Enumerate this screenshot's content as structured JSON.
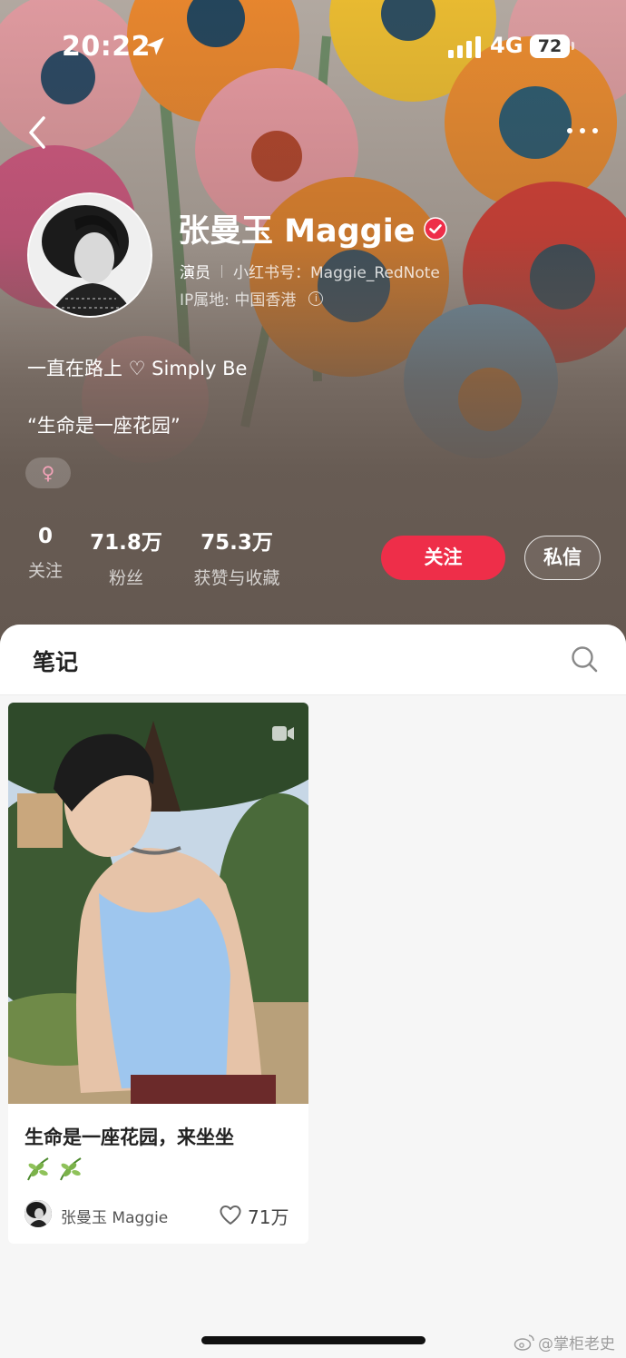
{
  "status_bar": {
    "time": "20:22",
    "network": "4G",
    "battery": "72"
  },
  "profile": {
    "name": "张曼玉 Maggie",
    "role": "演员",
    "redbook_id": "小红书号：Maggie_RedNote",
    "ip_location": "IP属地: 中国香港",
    "bio_line1": "一直在路上 ♡ Simply Be",
    "bio_line2": "“生命是一座花园”",
    "gender_symbol": "♀"
  },
  "stats": [
    {
      "value": "0",
      "label": "关注"
    },
    {
      "value": "71.8万",
      "label": "粉丝"
    },
    {
      "value": "75.3万",
      "label": "获赞与收藏"
    }
  ],
  "actions": {
    "follow_label": "关注",
    "message_label": "私信"
  },
  "tabs": {
    "notes_label": "笔记"
  },
  "note_card": {
    "title": "生命是一座花园，来坐坐",
    "title_emoji": "🌿🌿",
    "author": "张曼玉 Maggie",
    "likes": "71万"
  },
  "watermark": "@掌柜老史",
  "colors": {
    "accent_red": "#ee2e49",
    "verified_red": "#ee2e49",
    "header_brown": "#645850"
  },
  "icons": [
    "back-icon",
    "more-icon",
    "location-arrow-icon",
    "signal-icon",
    "verified-badge-icon",
    "info-icon",
    "search-icon",
    "video-play-icon",
    "heart-icon",
    "leaf-icon",
    "weibo-icon"
  ]
}
